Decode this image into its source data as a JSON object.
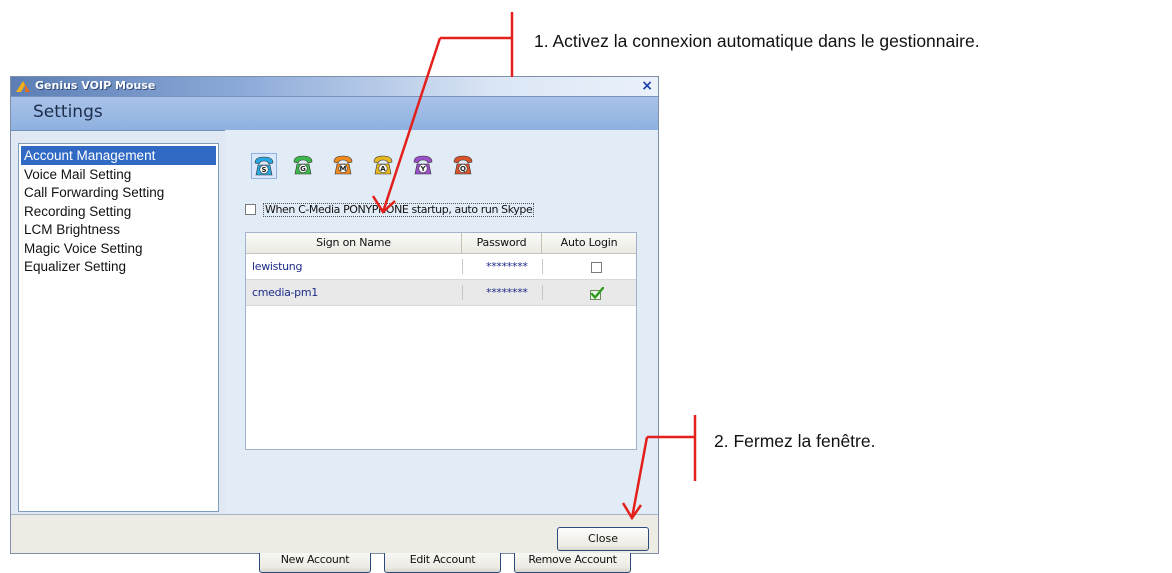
{
  "window": {
    "title": "Genius VOIP Mouse",
    "close_glyph": "×",
    "header": "Settings"
  },
  "sidebar": {
    "items": [
      {
        "label": "Account Management",
        "selected": true
      },
      {
        "label": "Voice Mail Setting"
      },
      {
        "label": "Call Forwarding Setting"
      },
      {
        "label": "Recording Setting"
      },
      {
        "label": "LCM Brightness"
      },
      {
        "label": "Magic Voice Setting"
      },
      {
        "label": "Equalizer Setting"
      }
    ]
  },
  "messengers": [
    {
      "letter": "S",
      "icon": "skype-phone-icon",
      "color": "#2aa7de",
      "selected": true
    },
    {
      "letter": "G",
      "icon": "gtalk-phone-icon",
      "color": "#3db84a"
    },
    {
      "letter": "M",
      "icon": "msn-phone-icon",
      "color": "#f08a1f"
    },
    {
      "letter": "A",
      "icon": "aim-phone-icon",
      "color": "#e8b820"
    },
    {
      "letter": "Y",
      "icon": "yahoo-phone-icon",
      "color": "#9a4fc8"
    },
    {
      "letter": "Q",
      "icon": "qq-phone-icon",
      "color": "#d9542b"
    }
  ],
  "auto_run": {
    "label": "When C-Media PONYPHONE startup, auto run Skype",
    "checked": false
  },
  "accounts_table": {
    "columns": [
      "Sign on Name",
      "Password",
      "Auto Login"
    ],
    "rows": [
      {
        "name": "lewistung",
        "password": "********",
        "auto_login": false
      },
      {
        "name": "cmedia-pm1",
        "password": "********",
        "auto_login": true,
        "selected": true
      }
    ]
  },
  "buttons": {
    "new_account": "New Account",
    "edit_account": "Edit Account",
    "remove_account": "Remove Account",
    "close": "Close"
  },
  "annotations": {
    "step1": "1. Activez la connexion automatique dans le gestionnaire.",
    "step2": "2. Fermez la fenêtre.",
    "arrow_color": "#e3201b"
  }
}
